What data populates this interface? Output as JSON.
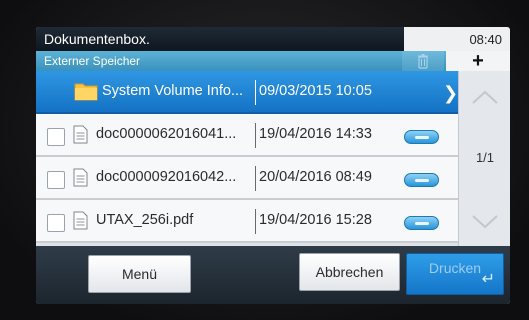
{
  "header": {
    "title": "Dokumentenbox.",
    "time": "08:40"
  },
  "subheader": {
    "title": "Externer Speicher",
    "trash_icon": "trash-icon",
    "add_label": "+"
  },
  "files": [
    {
      "name": "System Volume Info...",
      "date": "09/03/2015 10:05",
      "type": "folder",
      "selected": true
    },
    {
      "name": "doc0000062016041...",
      "date": "19/04/2016 14:33",
      "type": "document",
      "selected": false
    },
    {
      "name": "doc0000092016042...",
      "date": "20/04/2016 08:49",
      "type": "document",
      "selected": false
    },
    {
      "name": "UTAX_256i.pdf",
      "date": "19/04/2016 15:28",
      "type": "document",
      "selected": false
    }
  ],
  "pagination": {
    "indicator": "1/1"
  },
  "footer": {
    "menu_label": "Menü",
    "cancel_label": "Abbrechen",
    "print_label": "Drucken"
  },
  "colors": {
    "accent": "#1a7fd4",
    "title_bar": "#131c26",
    "subtitle_bar": "#4aa1c9"
  }
}
